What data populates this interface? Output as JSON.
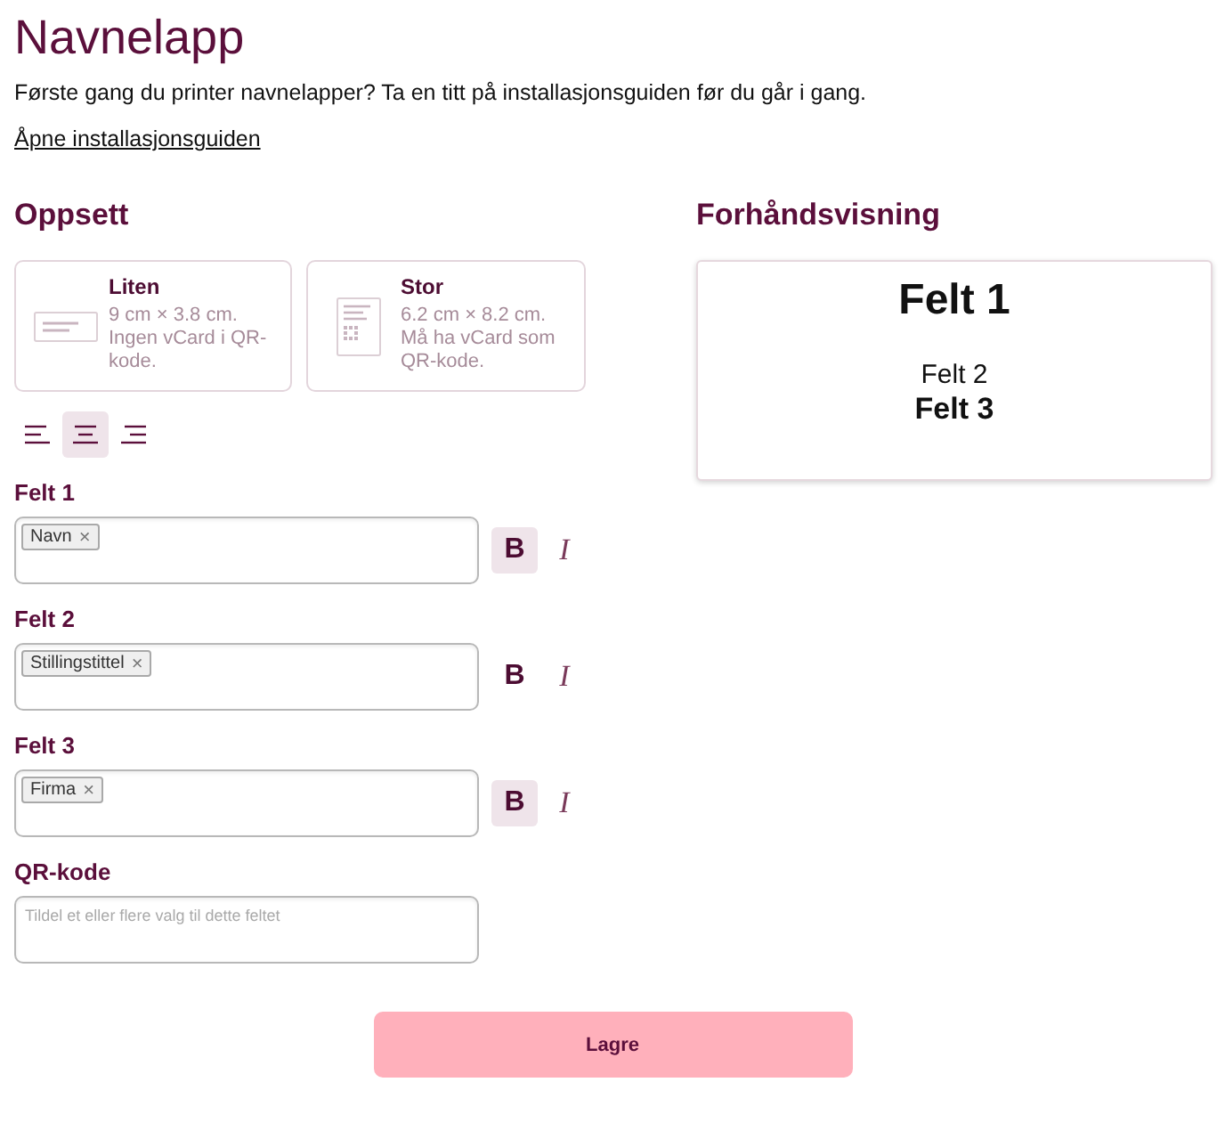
{
  "header": {
    "title": "Navnelapp",
    "intro": "Første gang du printer navnelapper? Ta en titt på installasjonsguiden før du går i gang.",
    "guide_link": "Åpne installasjonsguiden"
  },
  "setup": {
    "heading": "Oppsett",
    "sizes": [
      {
        "kind": "landscape",
        "name": "Liten",
        "dimensions": "9 cm × 3.8 cm.",
        "note": "Ingen vCard i QR-kode.",
        "selected": false
      },
      {
        "kind": "portrait",
        "name": "Stor",
        "dimensions": "6.2 cm × 8.2 cm.",
        "note": "Må ha vCard som QR-kode.",
        "selected": false
      }
    ],
    "alignments": [
      {
        "kind": "left",
        "selected": false
      },
      {
        "kind": "center",
        "selected": true
      },
      {
        "kind": "right",
        "selected": false
      }
    ],
    "fields": [
      {
        "label": "Felt 1",
        "tags": [
          {
            "text": "Navn",
            "remove": "×"
          }
        ],
        "bold_label": "B",
        "italic_label": "I",
        "bold": true,
        "italic": false
      },
      {
        "label": "Felt 2",
        "tags": [
          {
            "text": "Stillingstittel",
            "remove": "×"
          }
        ],
        "bold_label": "B",
        "italic_label": "I",
        "bold": false,
        "italic": false
      },
      {
        "label": "Felt 3",
        "tags": [
          {
            "text": "Firma",
            "remove": "×"
          }
        ],
        "bold_label": "B",
        "italic_label": "I",
        "bold": true,
        "italic": false
      }
    ],
    "qr": {
      "label": "QR-kode",
      "placeholder": "Tildel et eller flere valg til dette feltet"
    }
  },
  "preview": {
    "heading": "Forhåndsvisning",
    "lines": [
      {
        "kind": "title",
        "text": "Felt 1"
      },
      {
        "kind": "line",
        "text": "Felt 2"
      },
      {
        "kind": "line",
        "text": "Felt 3"
      }
    ]
  },
  "save_button": "Lagre"
}
